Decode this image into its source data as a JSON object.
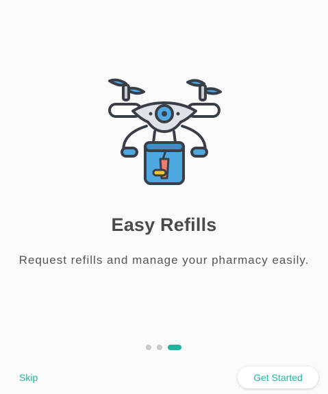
{
  "onboarding": {
    "title": "Easy Refills",
    "subtitle": "Request refills and manage your pharmacy easily.",
    "illustration_icon": "drone-delivery-icon",
    "pager": {
      "count": 3,
      "active_index": 2
    },
    "skip_label": "Skip",
    "get_started_label": "Get Started"
  },
  "colors": {
    "accent": "#1bb49e",
    "title": "#4a4a4a",
    "subtitle": "#555555",
    "dot_inactive": "#c8c8c8",
    "background": "#fafafa"
  }
}
